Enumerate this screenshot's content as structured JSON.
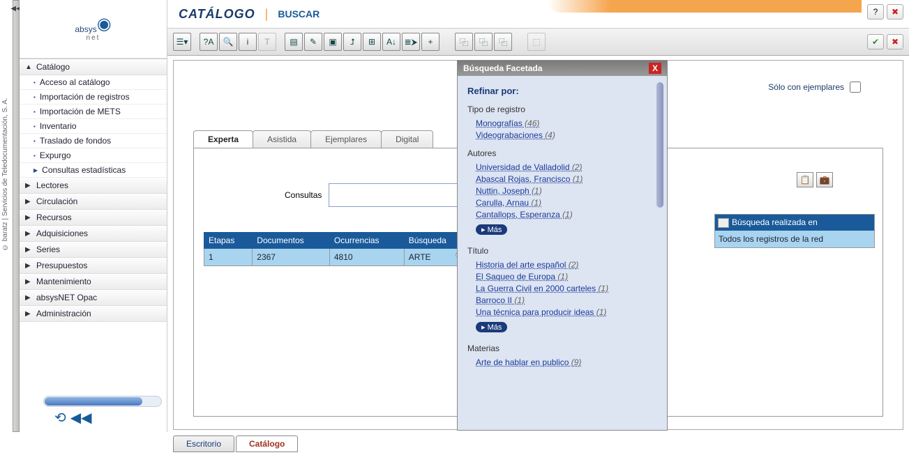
{
  "brand": {
    "name_a": "absys",
    "name_b": "net",
    "sub": "net",
    "company": "© baratz | Servicios de Teledocumentación, S. A."
  },
  "header": {
    "title": "CATÁLOGO",
    "action": "BUSCAR"
  },
  "sidebar": {
    "expanded": "Catálogo",
    "sub": [
      "Acceso al catálogo",
      "Importación de registros",
      "Importación de METS",
      "Inventario",
      "Traslado de fondos",
      "Expurgo",
      "Consultas estadísticas"
    ],
    "items": [
      "Lectores",
      "Circulación",
      "Recursos",
      "Adquisiciones",
      "Series",
      "Presupuestos",
      "Mantenimiento",
      "absysNET Opac",
      "Administración"
    ]
  },
  "solo_label": "Sólo con ejemplares",
  "tabs": [
    "Experta",
    "Asistida",
    "Ejemplares",
    "Digital"
  ],
  "consultas_label": "Consultas",
  "table": {
    "headers": [
      "Etapas",
      "Documentos",
      "Ocurrencias",
      "Búsqueda"
    ],
    "row": [
      "1",
      "2367",
      "4810",
      "ARTE"
    ]
  },
  "right_table": {
    "header": "Búsqueda realizada en",
    "value": "Todos los registros de la red"
  },
  "facet": {
    "title": "Búsqueda Facetada",
    "refine": "Refinar por:",
    "sections": [
      {
        "name": "Tipo de registro",
        "items": [
          {
            "t": "Monografías",
            "c": "(46)"
          },
          {
            "t": "Videograbaciones",
            "c": "(4)"
          }
        ],
        "more": false
      },
      {
        "name": "Autores",
        "items": [
          {
            "t": "Universidad de Valladolid",
            "c": "(2)"
          },
          {
            "t": "Abascal Rojas, Francisco",
            "c": "(1)"
          },
          {
            "t": "Nuttin, Joseph",
            "c": "(1)"
          },
          {
            "t": "Carulla, Arnau",
            "c": "(1)"
          },
          {
            "t": "Cantallops, Esperanza",
            "c": "(1)"
          }
        ],
        "more": true
      },
      {
        "name": "Título",
        "items": [
          {
            "t": "Historia del arte español",
            "c": "(2)"
          },
          {
            "t": "El Saqueo de Europa",
            "c": "(1)"
          },
          {
            "t": "La Guerra Civil en 2000 carteles",
            "c": "(1)"
          },
          {
            "t": "Barroco II",
            "c": "(1)"
          },
          {
            "t": "Una técnica para producir ideas",
            "c": "(1)"
          }
        ],
        "more": true
      },
      {
        "name": "Materias",
        "items": [
          {
            "t": "Arte de hablar en publico",
            "c": "(9)"
          }
        ],
        "more": false
      }
    ],
    "more_label": "▸ Más"
  },
  "bottom_tabs": [
    "Escritorio",
    "Catálogo"
  ]
}
